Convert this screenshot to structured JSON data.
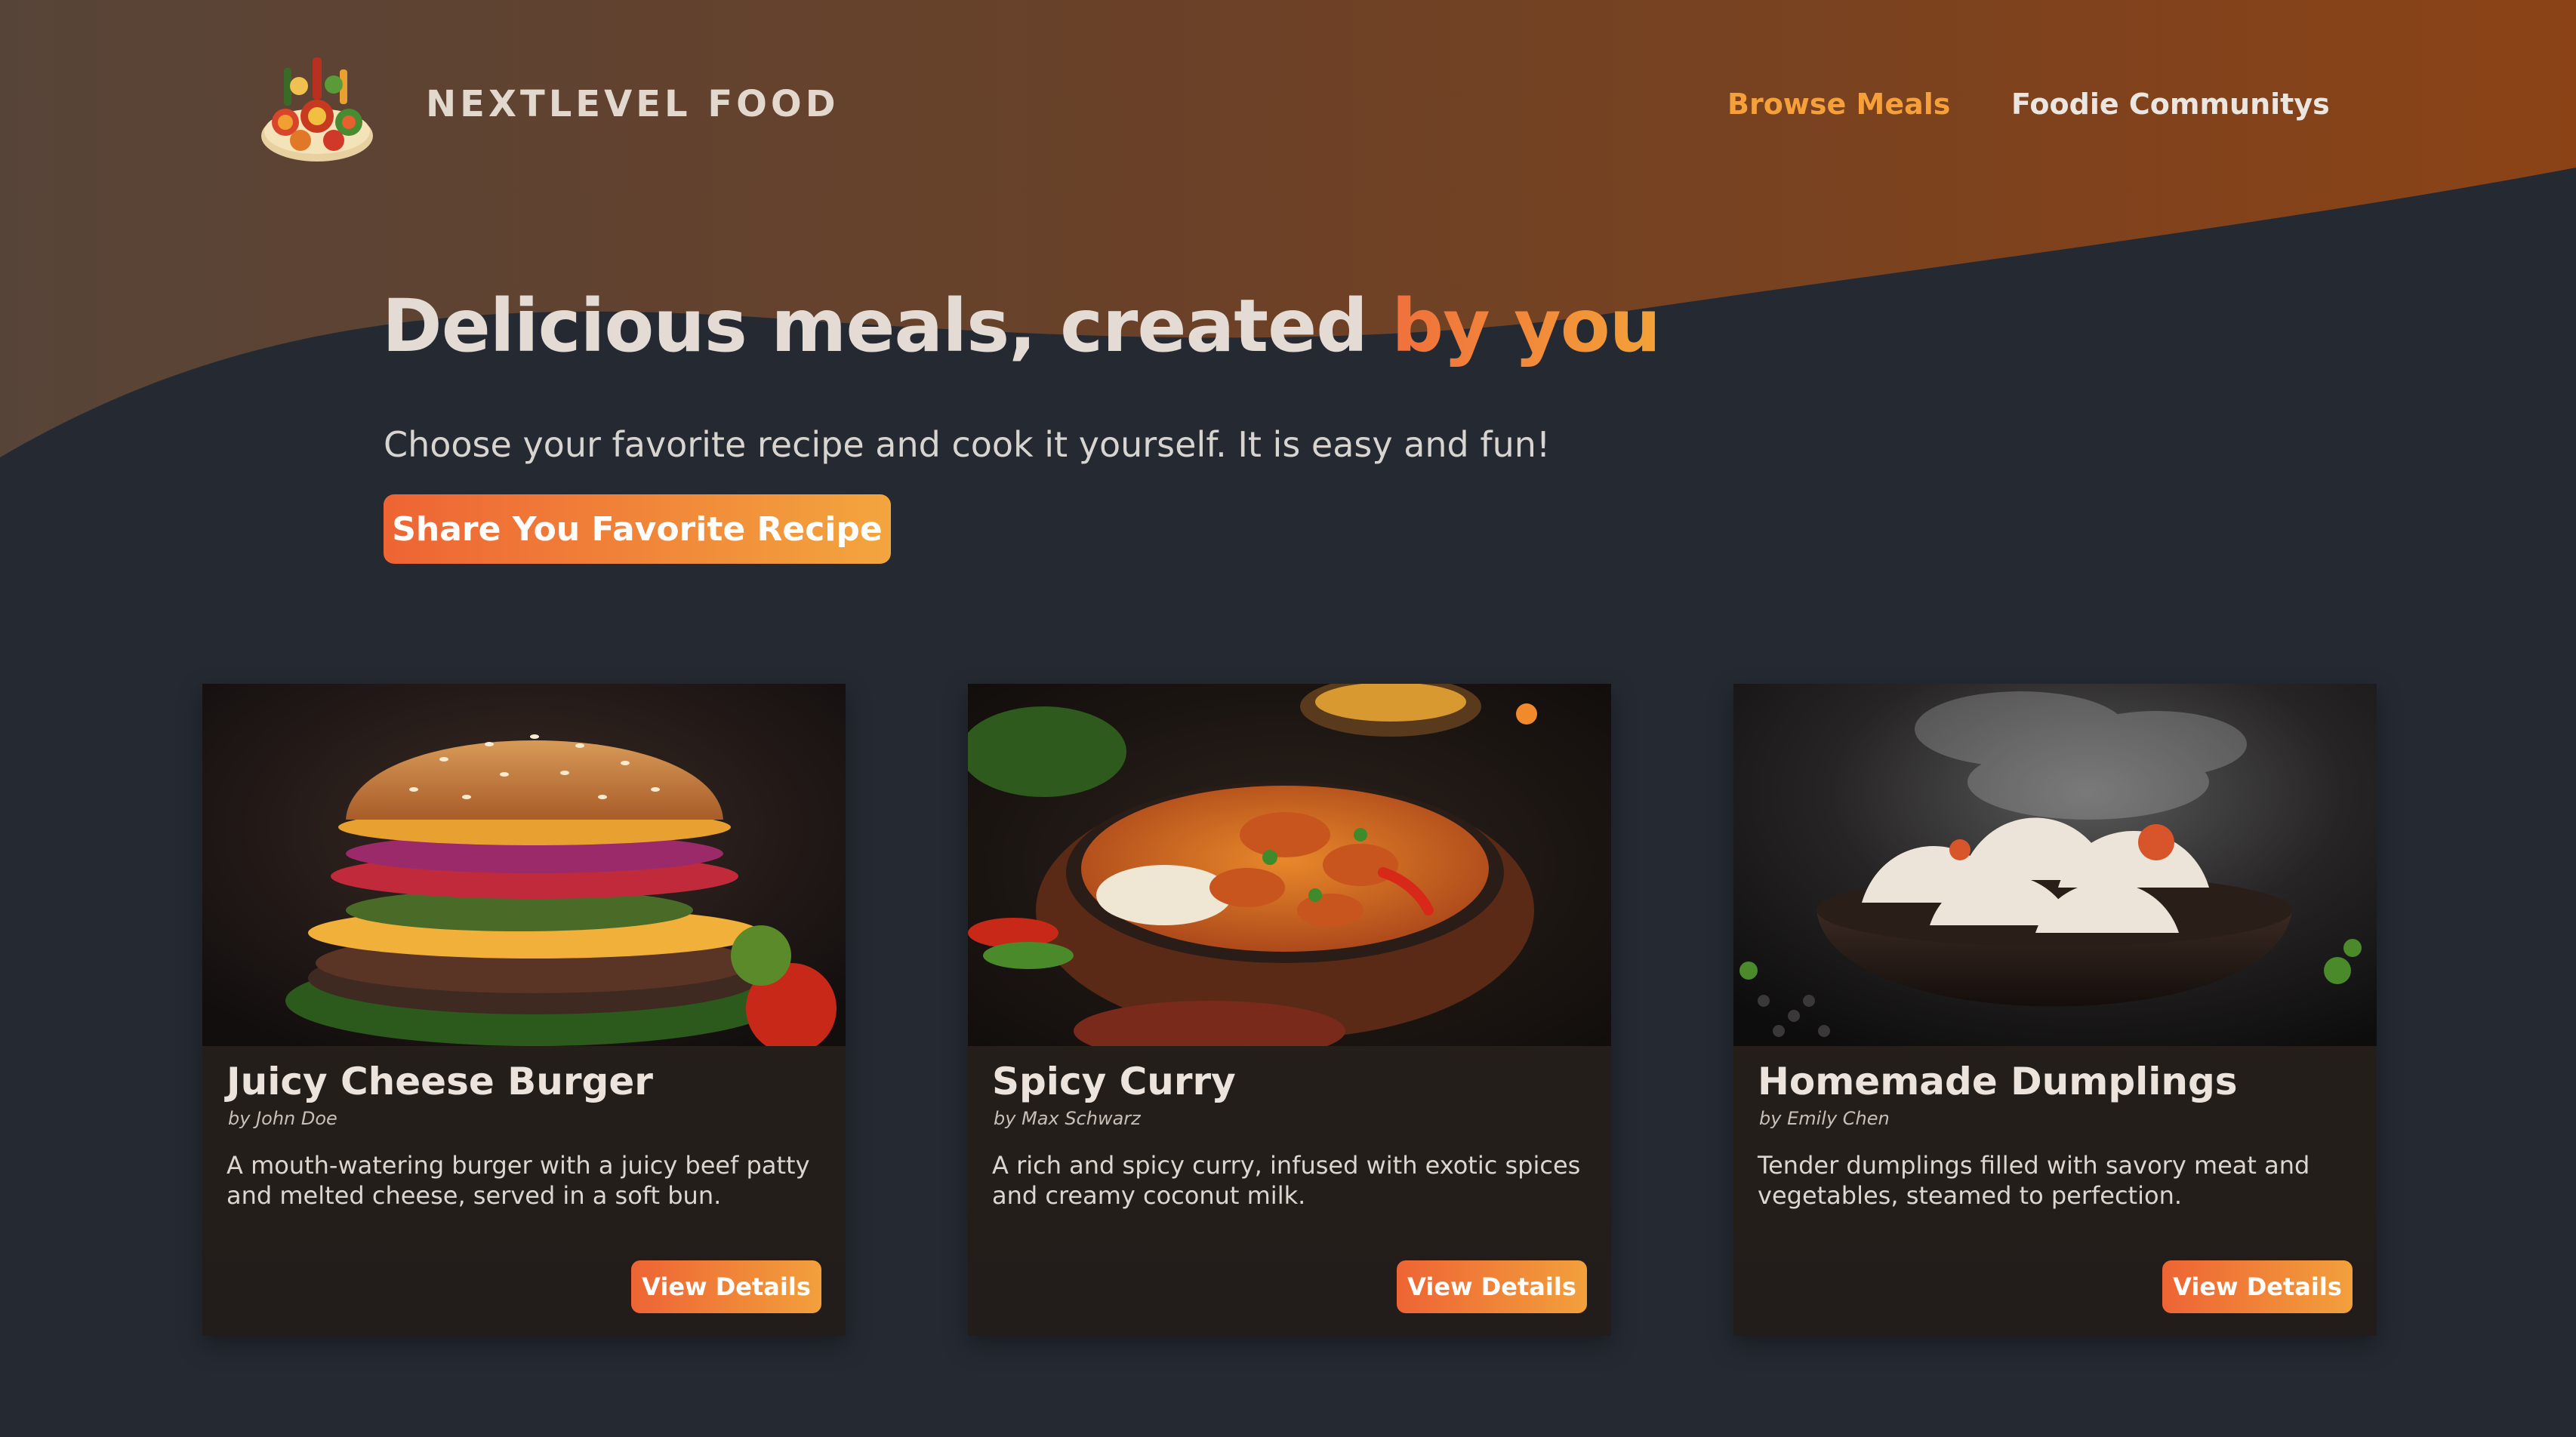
{
  "brand": {
    "name": "NEXTLEVEL FOOD",
    "logo_icon": "food-platter-logo-icon"
  },
  "nav": {
    "items": [
      {
        "label": "Browse Meals",
        "active": true
      },
      {
        "label": "Foodie Communitys",
        "active": false
      }
    ]
  },
  "hero": {
    "title_main": "Delicious meals, created",
    "title_highlight": "by you",
    "subtitle": "Choose your favorite recipe and cook it yourself. It is easy and fun!",
    "cta_label": "Share You Favorite Recipe"
  },
  "meals": [
    {
      "title": "Juicy Cheese Burger",
      "author": "by John Doe",
      "summary": "A mouth-watering burger with a juicy beef patty and melted cheese, served in a soft bun.",
      "button_label": "View Details",
      "image_icon": "burger-photo"
    },
    {
      "title": "Spicy Curry",
      "author": "by Max Schwarz",
      "summary": "A rich and spicy curry, infused with exotic spices and creamy coconut milk.",
      "button_label": "View Details",
      "image_icon": "curry-photo"
    },
    {
      "title": "Homemade Dumplings",
      "author": "by Emily Chen",
      "summary": "Tender dumplings filled with savory meat and vegetables, steamed to perfection.",
      "button_label": "View Details",
      "image_icon": "dumplings-photo"
    }
  ],
  "colors": {
    "background": "#252a32",
    "accent_start": "#ee6434",
    "accent_end": "#f3a53e",
    "nav_active": "#f5a03a",
    "header_wave_left": "#5a4438",
    "header_wave_right": "#8a4418"
  }
}
